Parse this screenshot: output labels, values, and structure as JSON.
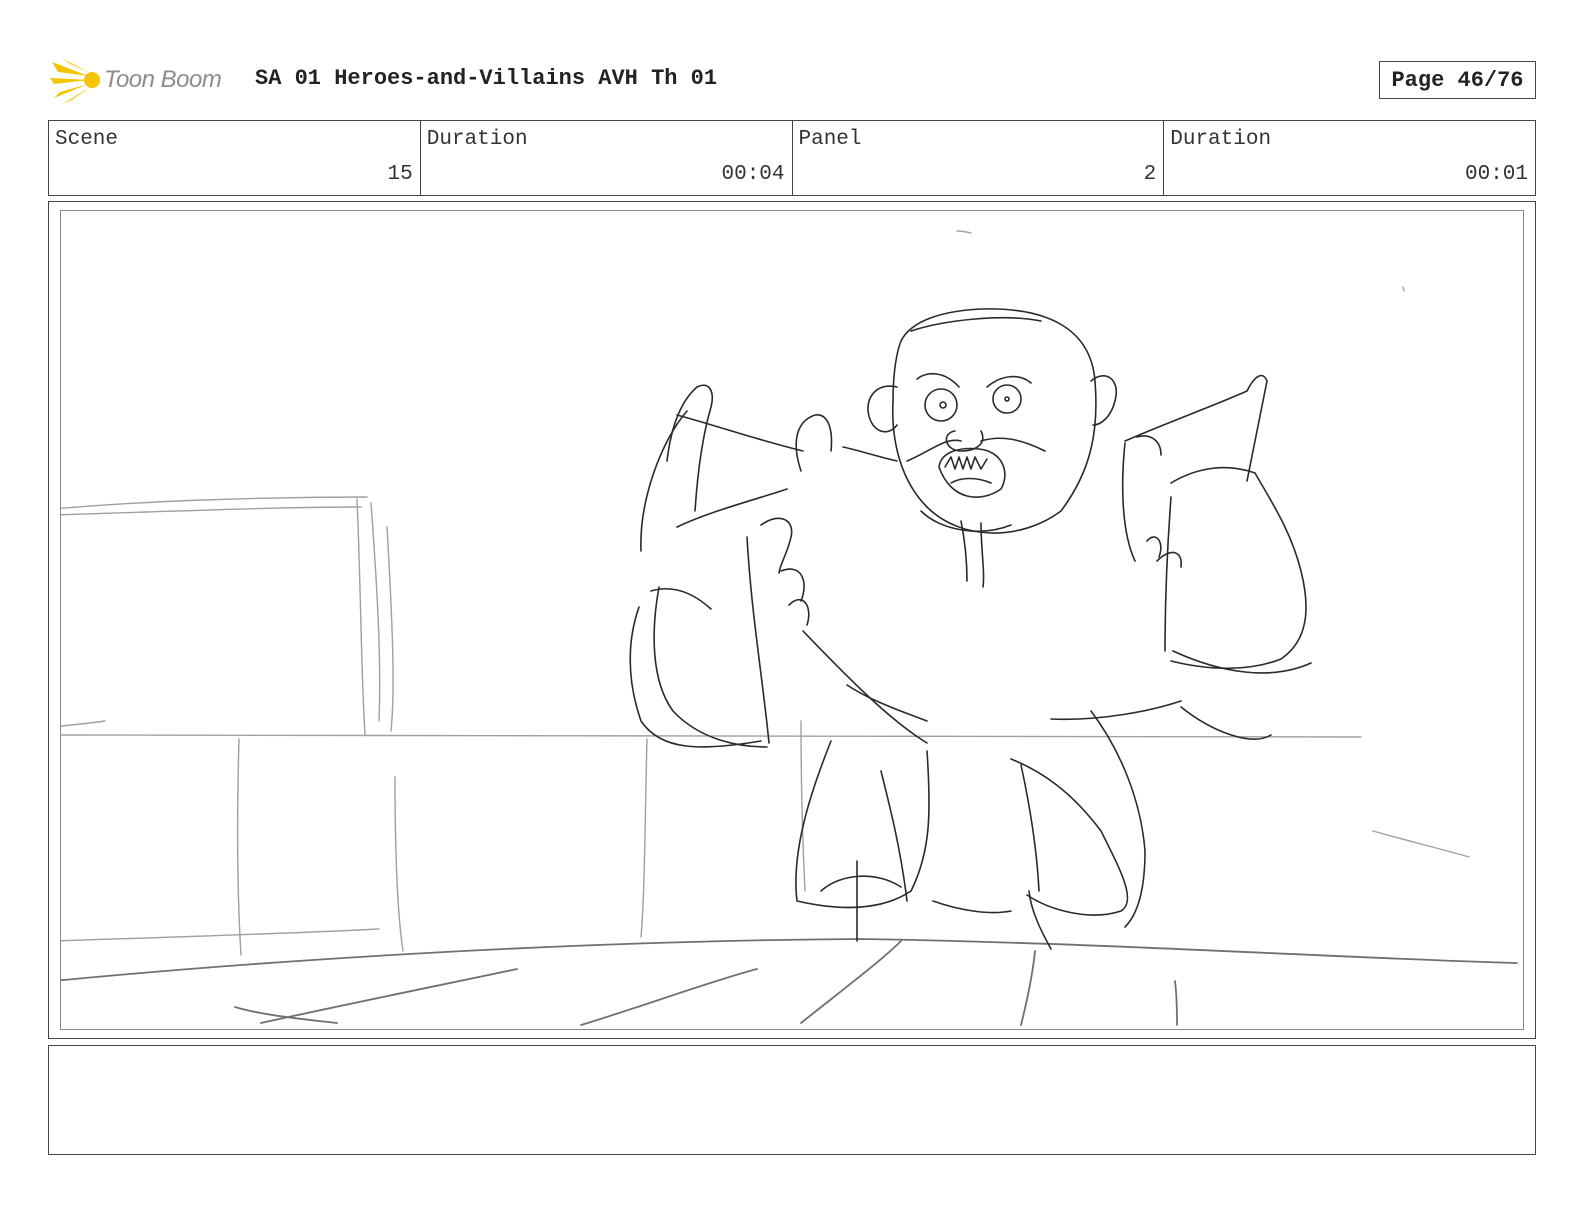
{
  "header": {
    "logo_text": "Toon Boom",
    "title": "SA 01 Heroes-and-Villains AVH Th 01",
    "page_label": "Page 46/76"
  },
  "info": {
    "scene_label": "Scene",
    "scene_value": "15",
    "scene_duration_label": "Duration",
    "scene_duration_value": "00:04",
    "panel_label": "Panel",
    "panel_value": "2",
    "panel_duration_label": "Duration",
    "panel_duration_value": "00:01"
  },
  "notes": {
    "text": ""
  },
  "colors": {
    "logo_flame": "#f5c400",
    "logo_text": "#8c8c8c",
    "sketch_dark": "#2a2a2a",
    "sketch_light": "#9a9a9a",
    "border": "#444444"
  }
}
